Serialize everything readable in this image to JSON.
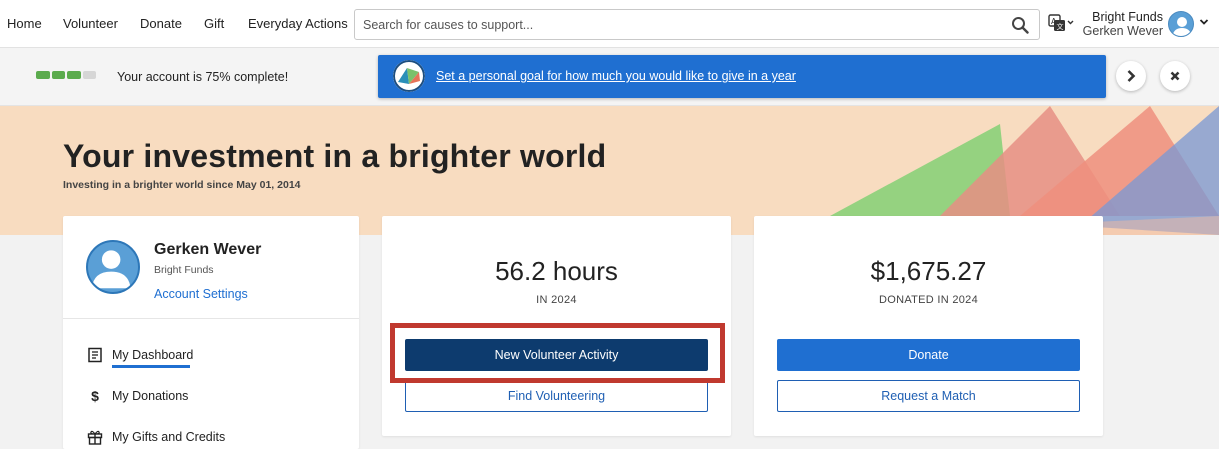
{
  "nav": {
    "links": [
      "Home",
      "Volunteer",
      "Donate",
      "Gift",
      "Everyday Actions"
    ],
    "search_placeholder": "Search for causes to support...",
    "org_name": "Bright Funds",
    "user_name": "Gerken Wever"
  },
  "progress": {
    "segments_total": 4,
    "segments_complete": 3,
    "percent": 75,
    "text": "Your account is 75% complete!"
  },
  "banner": {
    "text": "Set a personal goal for how much you would like to give in a year"
  },
  "hero": {
    "title": "Your investment in a brighter world",
    "subtitle": "Investing in a brighter world since May 01, 2014"
  },
  "profile": {
    "name": "Gerken Wever",
    "org": "Bright Funds",
    "settings_label": "Account Settings",
    "menu": [
      {
        "label": "My Dashboard",
        "icon": "dashboard-icon",
        "active": true
      },
      {
        "label": "My Donations",
        "icon": "dollar-icon",
        "active": false
      },
      {
        "label": "My Gifts and Credits",
        "icon": "gift-icon",
        "active": false
      }
    ]
  },
  "hours_card": {
    "value": "56.2 hours",
    "label": "IN 2024",
    "primary_button": "New Volunteer Activity",
    "secondary_button": "Find Volunteering"
  },
  "donate_card": {
    "value": "$1,675.27",
    "label": "DONATED IN 2024",
    "primary_button": "Donate",
    "secondary_button": "Request a Match"
  },
  "colors": {
    "accent_blue": "#1f6fd1",
    "dark_navy": "#0d3b6e",
    "hero_bg": "#f8dcc0",
    "progress_green": "#5bab4d",
    "highlight_red": "#c0392f"
  }
}
